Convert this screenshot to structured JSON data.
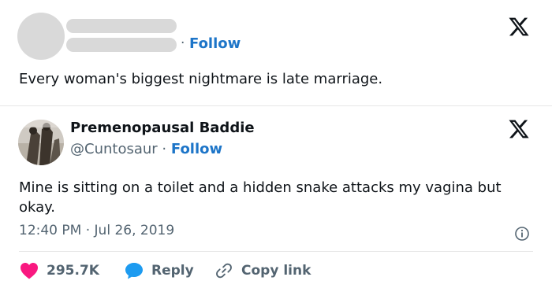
{
  "first_tweet": {
    "separator": "·",
    "follow_label": "Follow",
    "text": "Every woman's biggest nightmare is late marriage.",
    "logo_icon": "x-logo-icon"
  },
  "second_tweet": {
    "author_name": "Premenopausal Baddie",
    "handle": "@Cuntosaur",
    "separator": "·",
    "follow_label": "Follow",
    "text_line1": "Mine is sitting on a toilet and a hidden snake attacks my vagina but",
    "text_line2": "okay.",
    "timestamp": "12:40 PM · Jul 26, 2019",
    "logo_icon": "x-logo-icon",
    "info_icon": "info-icon"
  },
  "actions": {
    "like_count": "295.7K",
    "reply_label": "Reply",
    "copy_label": "Copy link"
  },
  "colors": {
    "accent_blue": "#1d75c8",
    "secondary_text": "#536471",
    "like_red": "#f91880",
    "reply_blue": "#1d9bf0"
  }
}
